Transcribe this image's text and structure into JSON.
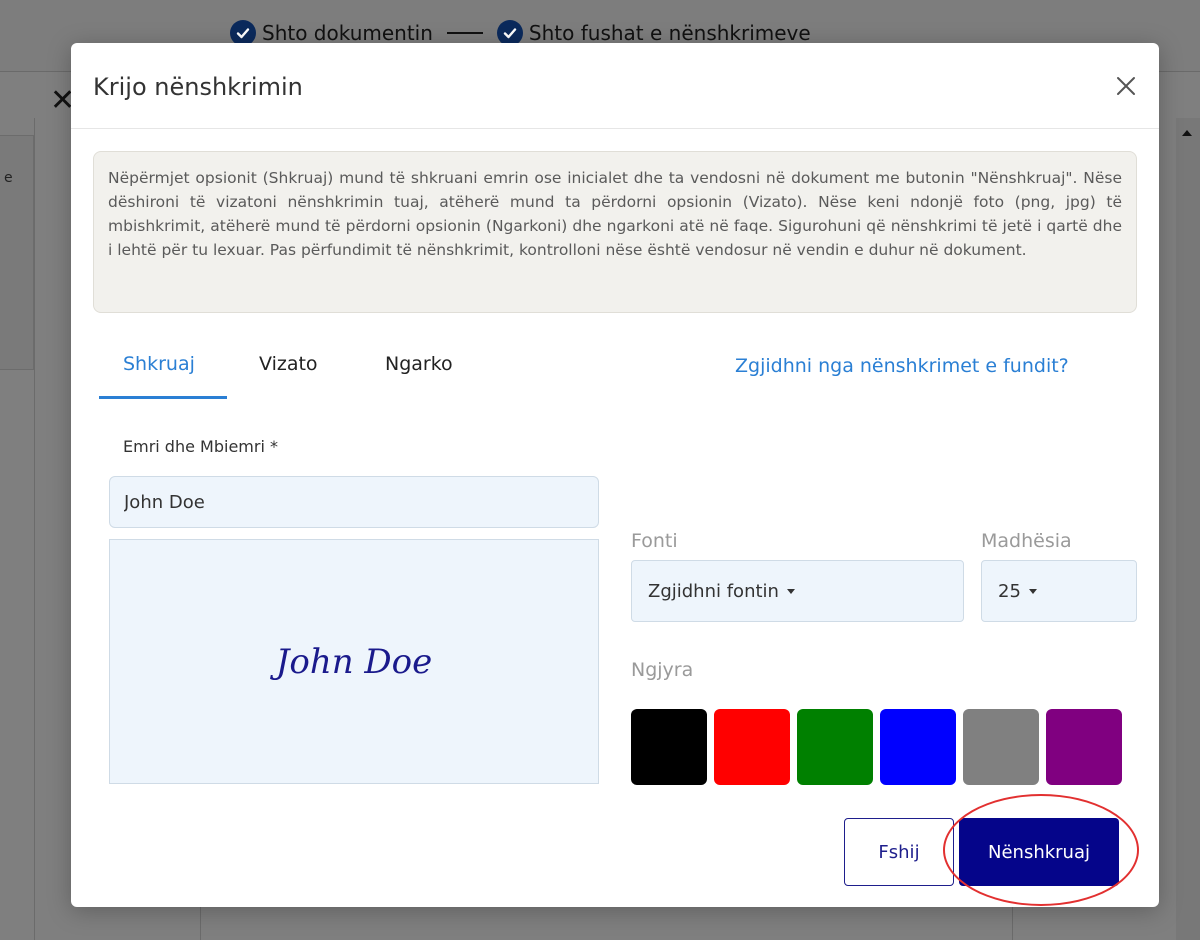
{
  "background": {
    "steps": [
      {
        "label": "Shto dokumentin"
      },
      {
        "label": "Shto fushat e nënshkrimeve"
      }
    ],
    "edge_text": "e"
  },
  "modal": {
    "title": "Krijo nënshkrimin",
    "info": "Nëpërmjet opsionit (Shkruaj) mund të shkruani emrin ose inicialet dhe ta vendosni në dokument me butonin \"Nënshkruaj\". Nëse dëshironi të vizatoni nënshkrimin tuaj, atëherë mund ta përdorni opsionin (Vizato). Nëse keni ndonjë foto (png, jpg) të mbishkrimit, atëherë mund të përdorni opsionin (Ngarkoni) dhe ngarkoni atë në faqe. Sigurohuni që nënshkrimi të jetë i qartë dhe i lehtë për tu lexuar. Pas përfundimit të nënshkrimit, kontrolloni nëse është vendosur në vendin e duhur në dokument.",
    "tabs": [
      {
        "label": "Shkruaj",
        "active": true
      },
      {
        "label": "Vizato",
        "active": false
      },
      {
        "label": "Ngarko",
        "active": false
      }
    ],
    "recent_link": "Zgjidhni nga nënshkrimet e fundit?",
    "name_label": "Emri dhe Mbiemri *",
    "name_value": "John Doe",
    "signature_preview": "John Doe",
    "font_label": "Fonti",
    "font_select": "Zgjidhni fontin",
    "size_label": "Madhësia",
    "size_select": "25",
    "color_label": "Ngjyra",
    "colors": [
      "#000000",
      "#ff0000",
      "#008000",
      "#0000ff",
      "#808080",
      "#800080"
    ],
    "signature_color": "#1a1a8c",
    "clear_button": "Fshij",
    "sign_button": "Nënshkruaj"
  }
}
